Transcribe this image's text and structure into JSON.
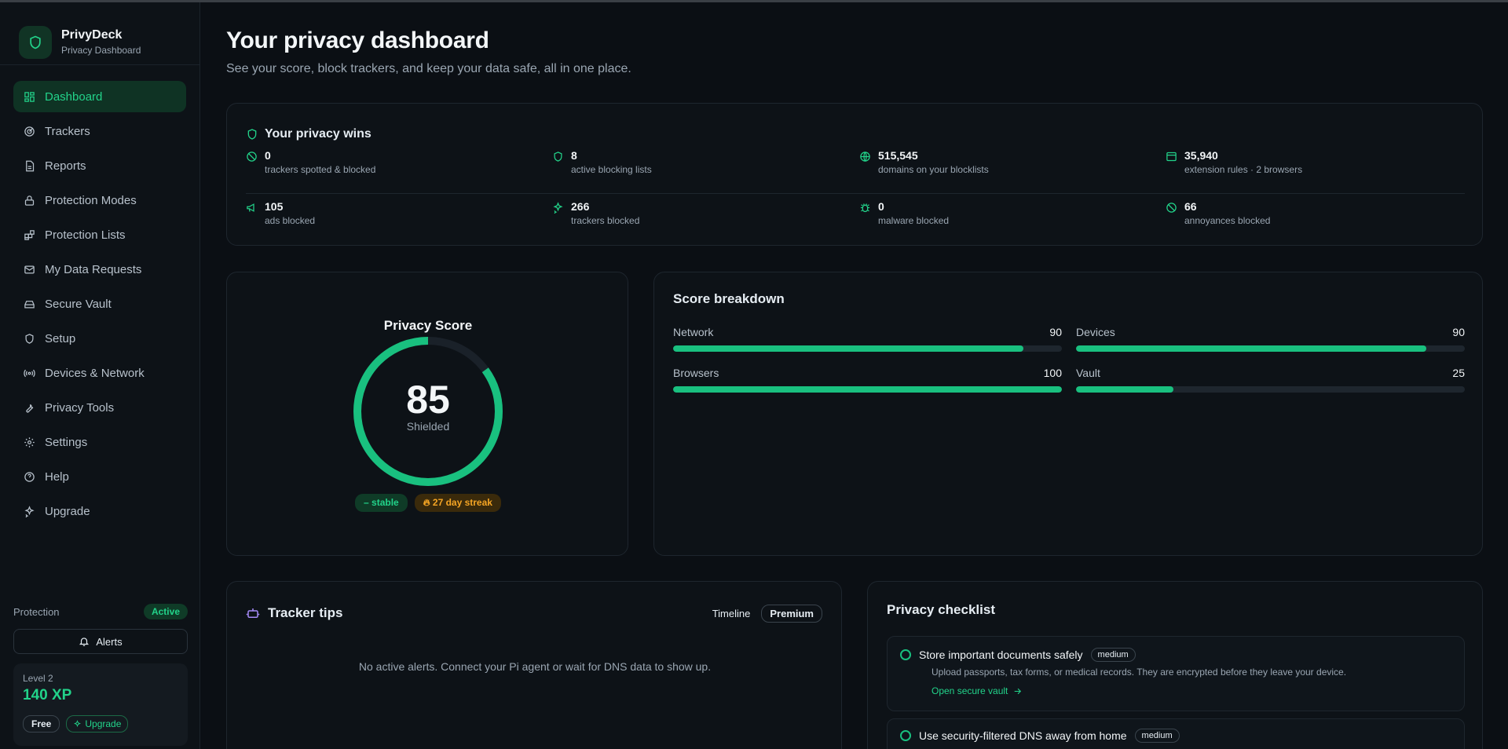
{
  "app": {
    "name": "PrivyDeck",
    "subtitle": "Privacy Dashboard"
  },
  "colors": {
    "accent": "#22d38a",
    "warning": "#f5a524"
  },
  "sidebar": {
    "items": [
      {
        "label": "Dashboard",
        "icon": "dashboard-icon",
        "active": true
      },
      {
        "label": "Trackers",
        "icon": "radar-icon"
      },
      {
        "label": "Reports",
        "icon": "file-icon"
      },
      {
        "label": "Protection Modes",
        "icon": "lock-icon"
      },
      {
        "label": "Protection Lists",
        "icon": "blocks-icon"
      },
      {
        "label": "My Data Requests",
        "icon": "mail-icon"
      },
      {
        "label": "Secure Vault",
        "icon": "drive-icon"
      },
      {
        "label": "Setup",
        "icon": "shield-icon"
      },
      {
        "label": "Devices & Network",
        "icon": "broadcast-icon"
      },
      {
        "label": "Privacy Tools",
        "icon": "wrench-icon"
      },
      {
        "label": "Settings",
        "icon": "gear-icon"
      },
      {
        "label": "Help",
        "icon": "help-icon"
      },
      {
        "label": "Upgrade",
        "icon": "sparkle-icon"
      }
    ],
    "protection_label": "Protection",
    "protection_status": "Active",
    "alerts_label": "Alerts",
    "level_label": "Level 2",
    "xp": "140 XP",
    "plan_label": "Free",
    "upgrade_label": "Upgrade"
  },
  "header": {
    "title": "Your privacy dashboard",
    "subtitle": "See your score, block trackers, and keep your data safe, all in one place."
  },
  "wins": {
    "title": "Your privacy wins",
    "stats": [
      {
        "value": "0",
        "label": "trackers spotted & blocked",
        "icon": "block-icon"
      },
      {
        "value": "8",
        "label": "active blocking lists",
        "icon": "shield-icon"
      },
      {
        "value": "515,545",
        "label": "domains on your blocklists",
        "icon": "globe-icon"
      },
      {
        "value": "35,940",
        "label": "extension rules · 2 browsers",
        "icon": "browser-icon"
      },
      {
        "value": "105",
        "label": "ads blocked",
        "icon": "megaphone-icon"
      },
      {
        "value": "266",
        "label": "trackers blocked",
        "icon": "sparkle-icon"
      },
      {
        "value": "0",
        "label": "malware blocked",
        "icon": "bug-icon"
      },
      {
        "value": "66",
        "label": "annoyances blocked",
        "icon": "block-icon"
      }
    ]
  },
  "score": {
    "title": "Privacy Score",
    "value": "85",
    "percent": 0.85,
    "status": "Shielded",
    "trend": "stable",
    "streak": "27 day streak"
  },
  "breakdown": {
    "title": "Score breakdown",
    "items": [
      {
        "label": "Network",
        "value": "90",
        "percent": 90
      },
      {
        "label": "Devices",
        "value": "90",
        "percent": 90
      },
      {
        "label": "Browsers",
        "value": "100",
        "percent": 100
      },
      {
        "label": "Vault",
        "value": "25",
        "percent": 25
      }
    ]
  },
  "tips": {
    "title": "Tracker tips",
    "tab_timeline": "Timeline",
    "tab_premium": "Premium",
    "empty": "No active alerts. Connect your Pi agent or wait for DNS data to show up."
  },
  "checklist": {
    "title": "Privacy checklist",
    "items": [
      {
        "name": "Store important documents safely",
        "tag": "medium",
        "desc": "Upload passports, tax forms, or medical records. They are encrypted before they leave your device.",
        "link": "Open secure vault"
      },
      {
        "name": "Use security-filtered DNS away from home",
        "tag": "medium"
      }
    ]
  }
}
